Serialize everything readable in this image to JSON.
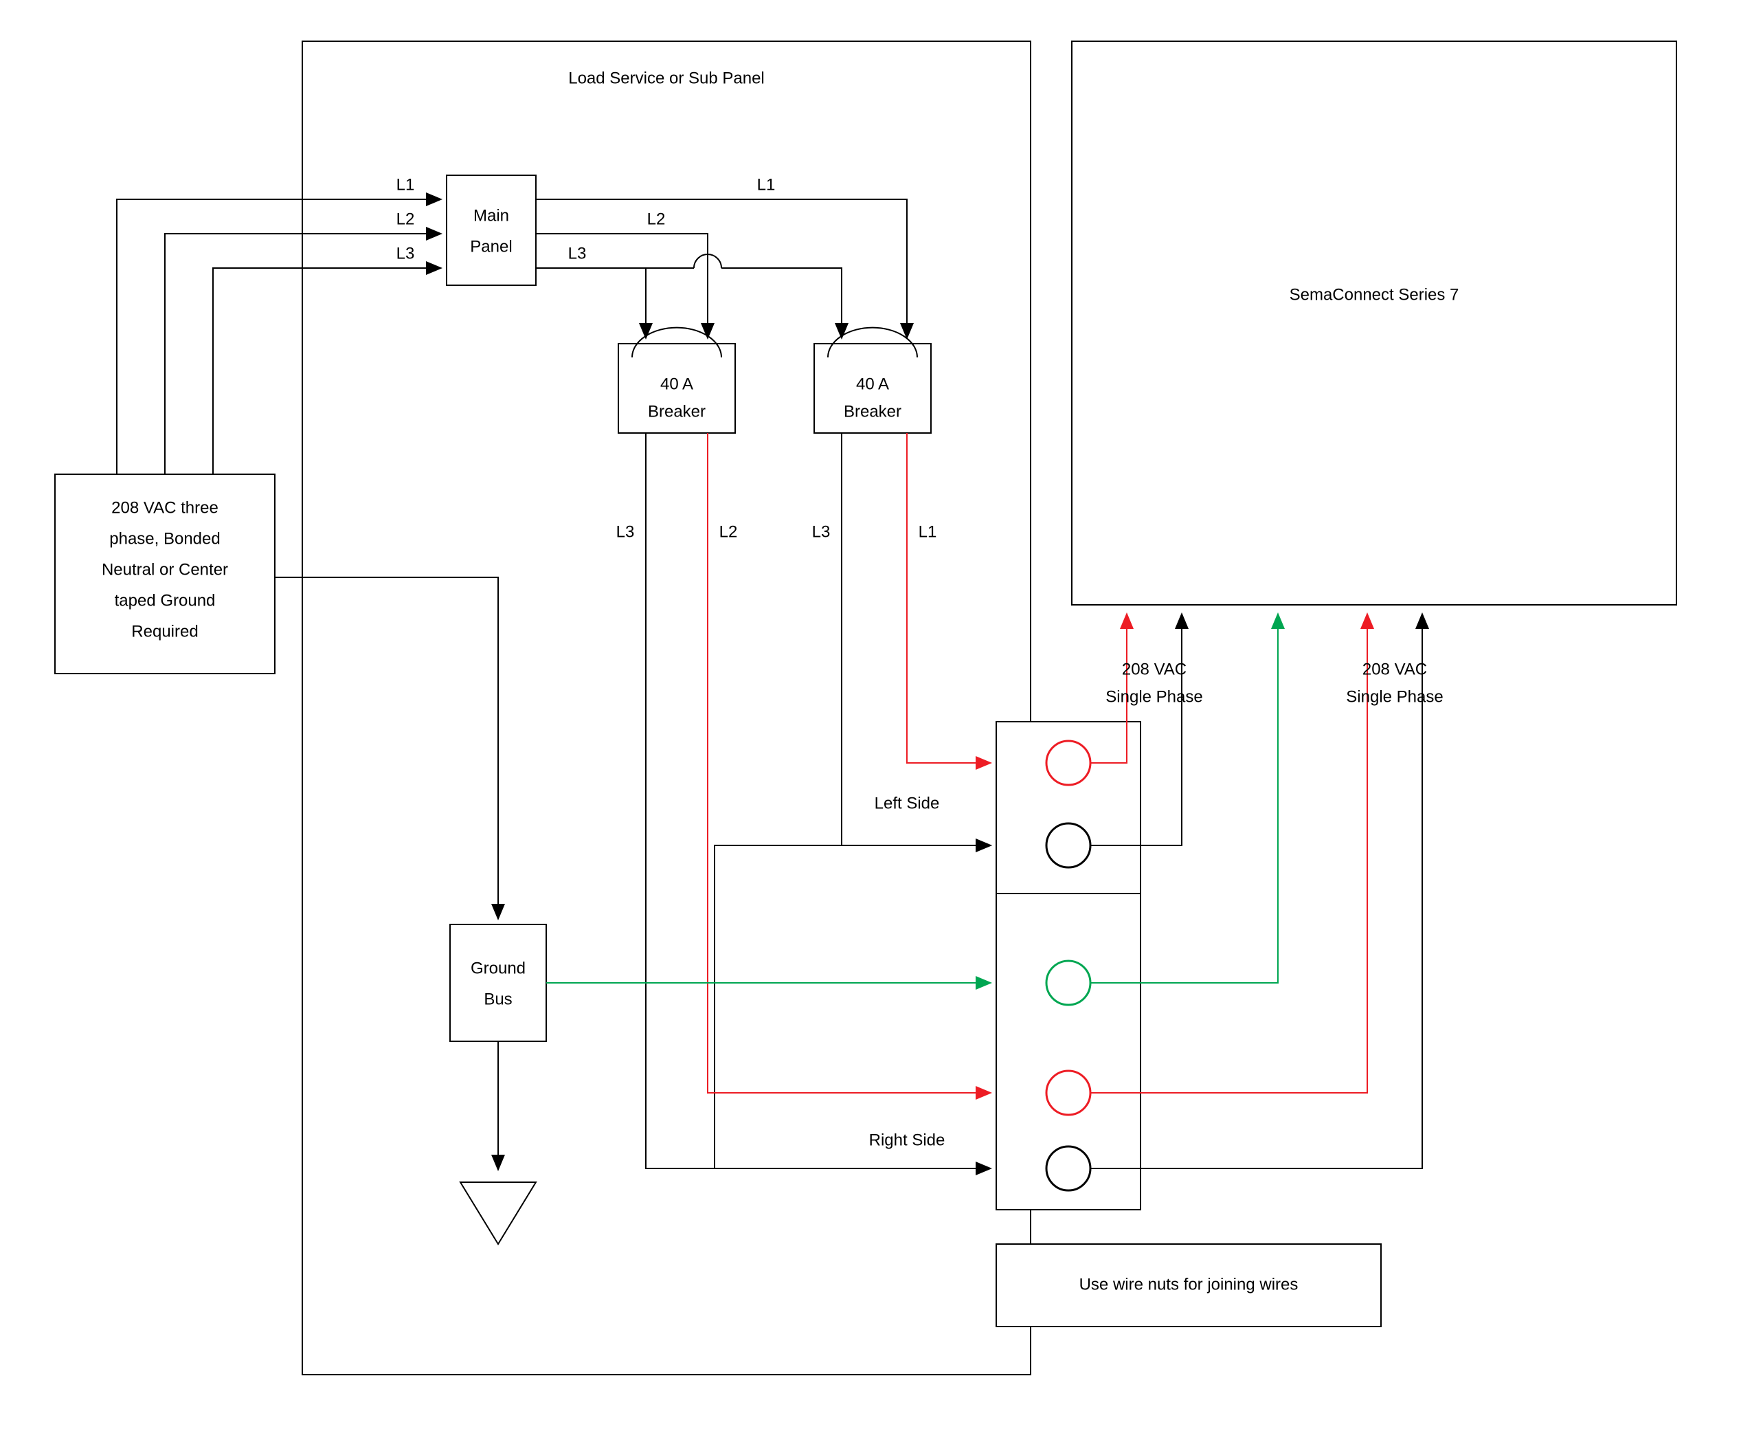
{
  "diagram": {
    "title": "Load Service or Sub Panel",
    "source": {
      "line1": "208 VAC three",
      "line2": "phase, Bonded",
      "line3": "Neutral or Center",
      "line4": "taped Ground",
      "line5": "Required"
    },
    "main_panel": {
      "line1": "Main",
      "line2": "Panel"
    },
    "breaker1": {
      "line1": "40 A",
      "line2": "Breaker"
    },
    "breaker2": {
      "line1": "40 A",
      "line2": "Breaker"
    },
    "ground_bus": {
      "line1": "Ground",
      "line2": "Bus"
    },
    "charger": "SemaConnect Series 7",
    "note": "Use wire nuts for joining wires",
    "phase1": {
      "label1": "208 VAC",
      "label2": "Single Phase"
    },
    "phase2": {
      "label1": "208 VAC",
      "label2": "Single Phase"
    },
    "lines": {
      "L1": "L1",
      "L2": "L2",
      "L3": "L3"
    },
    "sides": {
      "left": "Left Side",
      "right": "Right Side"
    },
    "colors": {
      "black": "#000000",
      "red": "#ed1c24",
      "green": "#00a651"
    }
  }
}
